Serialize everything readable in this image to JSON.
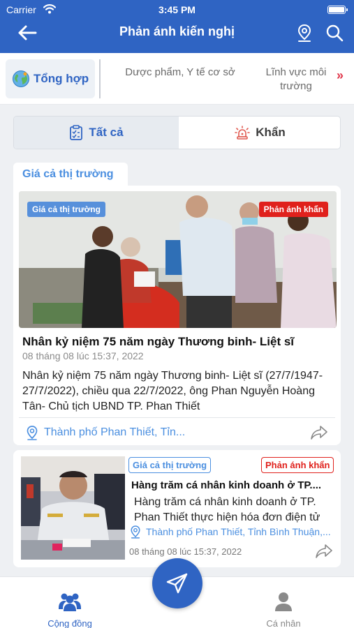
{
  "status_bar": {
    "carrier": "Carrier",
    "time": "3:45 PM"
  },
  "nav": {
    "title": "Phản ánh kiến nghị"
  },
  "categories": {
    "active": "Tổng hợp",
    "items": [
      "Dược phẩm, Y tế cơ sở",
      "Lĩnh vực môi trường"
    ],
    "more": "»"
  },
  "segment": {
    "all": "Tất cả",
    "urgent": "Khẩn"
  },
  "section_tab": "Giá cả thị trường",
  "posts": [
    {
      "category": "Giá cả thị trường",
      "urgent_badge": "Phản ánh khẩn",
      "title": "Nhân kỷ niệm 75 năm ngày Thương binh- Liệt sĩ",
      "date": "08 tháng 08 lúc 15:37, 2022",
      "description": "Nhân kỷ niệm 75 năm ngày Thương binh- Liệt sĩ (27/7/1947- 27/7/2022), chiều qua 22/7/2022, ông Phan Nguyễn Hoàng Tân- Chủ tịch UBND TP. Phan Thiết",
      "location": "Thành phố Phan Thiết, Tỉn..."
    },
    {
      "category": "Giá cả thị trường",
      "urgent_badge": "Phản ánh khẩn",
      "title": "Hàng trăm cá nhân kinh doanh ở TP....",
      "date": "08 tháng 08 lúc 15:37, 2022",
      "description": "Hàng trăm cá nhân kinh doanh ở TP. Phan Thiết thực hiện hóa đơn điện tử",
      "location": "Thành phố Phan Thiết, Tỉnh Bình Thuận,..."
    }
  ],
  "tabbar": {
    "community": "Cộng đồng",
    "profile": "Cá nhân"
  },
  "colors": {
    "primary": "#2f64c3",
    "accent_blue": "#4b8fe0",
    "urgent_red": "#e0211c"
  }
}
